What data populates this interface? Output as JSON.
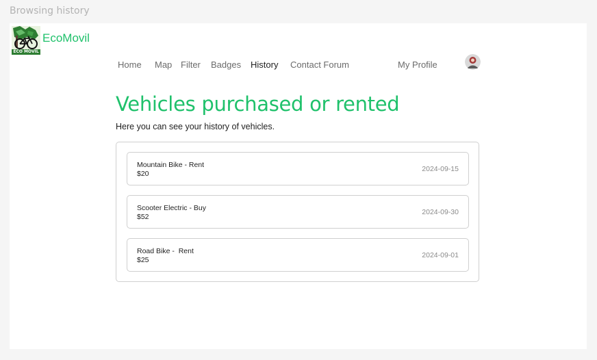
{
  "frame": {
    "title": "Browsing history"
  },
  "brand": {
    "name": "EcoMovil",
    "logo_text": "ECO MOVIL",
    "accent": "#1fc16b"
  },
  "nav": {
    "items": [
      {
        "label": "Home"
      },
      {
        "label": "Map"
      },
      {
        "label": "Filter"
      },
      {
        "label": "Badges"
      },
      {
        "label": "History",
        "active": true
      },
      {
        "label": "Contact Forum"
      }
    ],
    "profile_label": "My Profile",
    "avatar_icon": "avatar-icon"
  },
  "page": {
    "title": "Vehicles purchased or rented",
    "subtitle": "Here you can see your history of vehicles."
  },
  "history": [
    {
      "name": "Mountain Bike - Rent",
      "price": "$20",
      "date": "2024-09-15"
    },
    {
      "name": "Scooter Electric - Buy",
      "price": "$52",
      "date": "2024-09-30"
    },
    {
      "name": "Road Bike -  Rent",
      "price": "$25",
      "date": "2024-09-01"
    }
  ]
}
